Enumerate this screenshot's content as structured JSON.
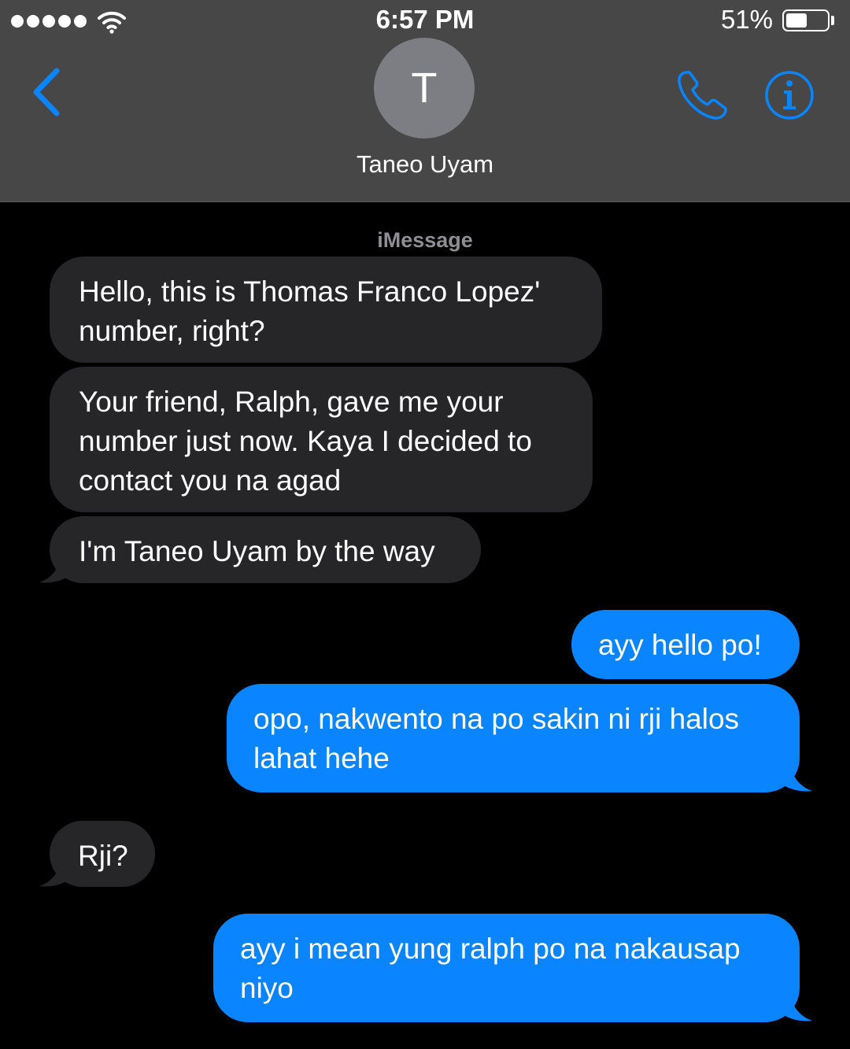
{
  "status_bar": {
    "time": "6:57 PM",
    "battery_percent": "51%",
    "battery_level": 0.51,
    "signal_bars": 5
  },
  "nav": {
    "back_icon": "chevron-left-icon",
    "contact_initial": "T",
    "contact_name": "Taneo Uyam",
    "call_icon": "phone-icon",
    "info_icon": "info-icon"
  },
  "conversation": {
    "service_label": "iMessage",
    "messages": [
      {
        "direction": "incoming",
        "text": "Hello, this is Thomas Franco Lopez'\nnumber, right?"
      },
      {
        "direction": "incoming",
        "text": "Your friend, Ralph, gave me your\nnumber just now. Kaya I decided to\ncontact you na agad"
      },
      {
        "direction": "incoming",
        "text": "I'm Taneo Uyam by the way"
      },
      {
        "direction": "outgoing",
        "text": "ayy hello po!"
      },
      {
        "direction": "outgoing",
        "text": "opo, nakwento na po sakin ni rji halos\nlahat hehe"
      },
      {
        "direction": "incoming",
        "text": "Rji?"
      },
      {
        "direction": "outgoing",
        "text": "ayy i mean yung ralph po na nakausap\nniyo"
      }
    ]
  },
  "colors": {
    "header_bg": "#474747",
    "accent": "#0a84ff",
    "incoming_bubble": "#262628",
    "outgoing_bubble": "#0a84ff",
    "background": "#000000"
  }
}
